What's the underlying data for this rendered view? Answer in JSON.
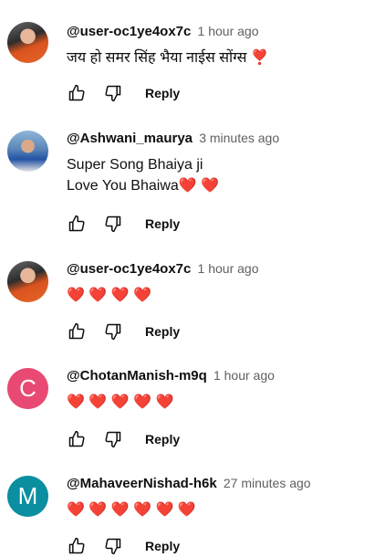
{
  "comments": [
    {
      "author": "@user-oc1ye4ox7c",
      "time": "1 hour ago",
      "text": "जय हो समर सिंह भैया नाईस सोंग्स ❣️",
      "avatar_letter": "",
      "reply_label": "Reply"
    },
    {
      "author": "@Ashwani_maurya",
      "time": "3 minutes ago",
      "text": "Super Song Bhaiya ji\nLove You Bhaiwa❤️ ❤️",
      "avatar_letter": "",
      "reply_label": "Reply"
    },
    {
      "author": "@user-oc1ye4ox7c",
      "time": "1 hour ago",
      "text": "❤️ ❤️ ❤️ ❤️",
      "avatar_letter": "",
      "reply_label": "Reply"
    },
    {
      "author": "@ChotanManish-m9q",
      "time": "1 hour ago",
      "text": "❤️ ❤️ ❤️ ❤️ ❤️",
      "avatar_letter": "C",
      "avatar_color": "#e84a73",
      "reply_label": "Reply"
    },
    {
      "author": "@MahaveerNishad-h6k",
      "time": "27 minutes ago",
      "text": "❤️ ❤️ ❤️ ❤️ ❤️ ❤️",
      "avatar_letter": "M",
      "avatar_color": "#0a8ea0",
      "reply_label": "Reply"
    }
  ],
  "icons": {
    "like": "thumbs-up-icon",
    "dislike": "thumbs-down-icon"
  }
}
